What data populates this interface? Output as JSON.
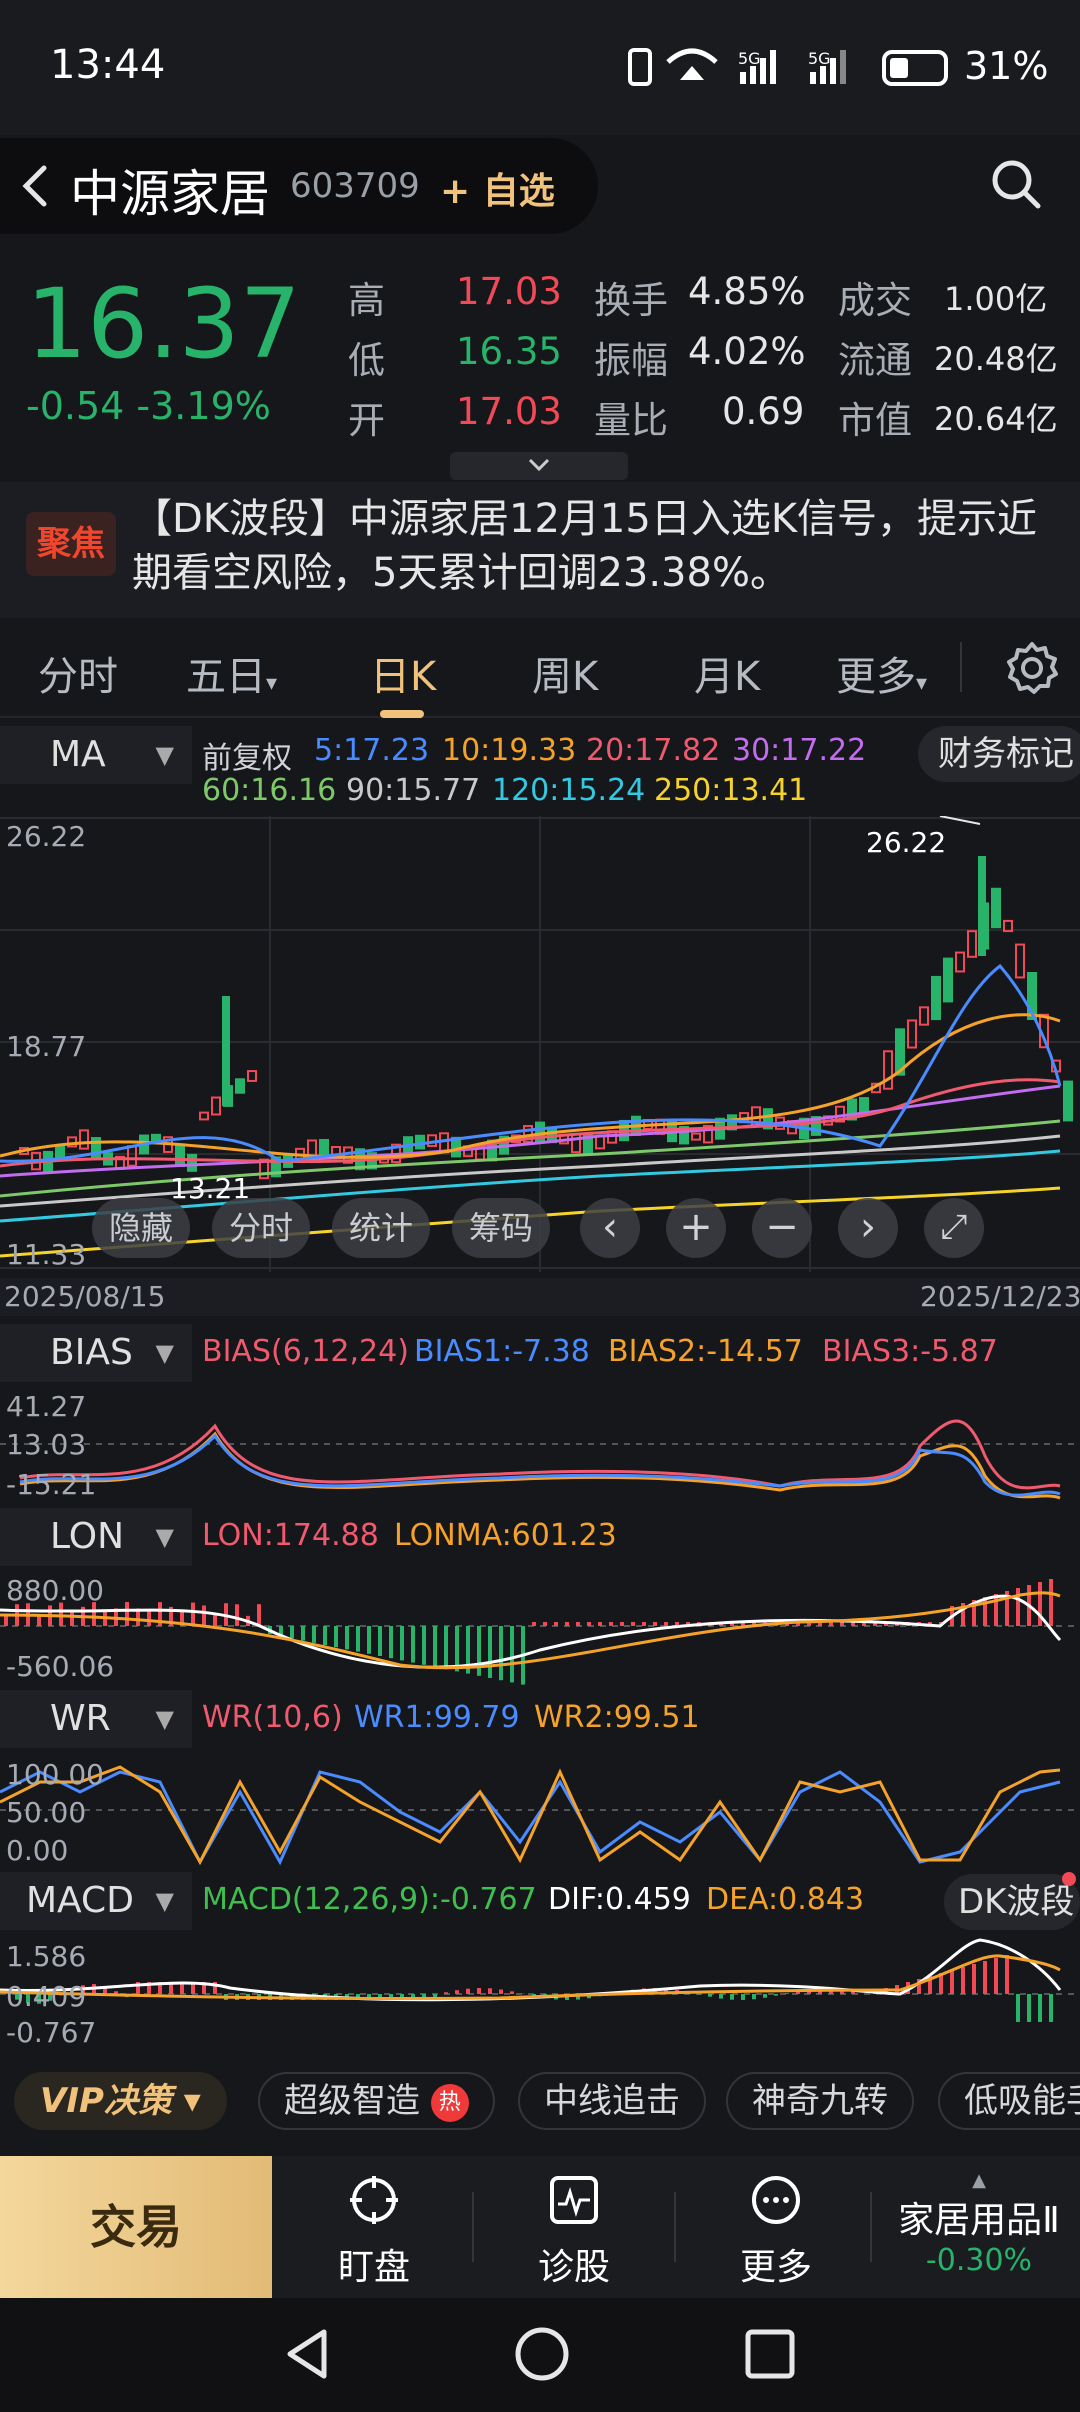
{
  "status": {
    "time": "13:44",
    "battery": "31%"
  },
  "header": {
    "name": "中源家居",
    "code": "603709",
    "add_label": "+ 自选"
  },
  "quote": {
    "price": "16.37",
    "change": "-0.54",
    "change_pct": "-3.19%",
    "rows": [
      {
        "k1": "高",
        "v1": "17.03",
        "k2": "换手",
        "v2": "4.85%",
        "k3": "成交",
        "v3": "1.00亿"
      },
      {
        "k1": "低",
        "v1": "16.35",
        "k2": "振幅",
        "v2": "4.02%",
        "k3": "流通",
        "v3": "20.48亿"
      },
      {
        "k1": "开",
        "v1": "17.03",
        "k2": "量比",
        "v2": "0.69",
        "k3": "市值",
        "v3": "20.64亿"
      }
    ]
  },
  "news": {
    "badge": "聚焦",
    "text": "【DK波段】中源家居12月15日入选K信号，提示近期看空风险，5天累计回调23.38%。"
  },
  "tabs": [
    "分时",
    "五日",
    "日K",
    "周K",
    "月K",
    "更多"
  ],
  "active_tab": "日K",
  "ma": {
    "selector": "MA",
    "adjust": "前复权",
    "items1": [
      {
        "t": "5:17.23",
        "c": "#4a8cff"
      },
      {
        "t": "10:19.33",
        "c": "#f5a22b"
      },
      {
        "t": "20:17.82",
        "c": "#f05a6e"
      },
      {
        "t": "30:17.22",
        "c": "#c46cf0"
      }
    ],
    "items2": [
      {
        "t": "60:16.16",
        "c": "#7ec86a"
      },
      {
        "t": "90:15.77",
        "c": "#c9c9c9"
      },
      {
        "t": "120:15.24",
        "c": "#33c9e0"
      },
      {
        "t": "250:13.41",
        "c": "#f5d32b"
      }
    ],
    "fin_mark": "财务标记"
  },
  "kchart": {
    "ymax": "26.22",
    "ymid": "18.77",
    "ymin": "11.33",
    "low_label": "13.21",
    "high_label": "26.22",
    "date_start": "2025/08/15",
    "date_end": "2025/12/23",
    "tools": [
      "隐藏",
      "分时",
      "统计",
      "筹码"
    ]
  },
  "bias": {
    "selector": "BIAS",
    "title": "BIAS(6,12,24)",
    "b1": "BIAS1:-7.38",
    "b2": "BIAS2:-14.57",
    "b3": "BIAS3:-5.87",
    "y1": "41.27",
    "y2": "13.03",
    "y3": "-15.21"
  },
  "lon": {
    "selector": "LON",
    "l1": "LON:174.88",
    "l2": "LONMA:601.23",
    "y1": "880.00",
    "y3": "-560.06"
  },
  "wr": {
    "selector": "WR",
    "title": "WR(10,6)",
    "w1": "WR1:99.79",
    "w2": "WR2:99.51",
    "y1": "100.00",
    "y2": "50.00",
    "y3": "0.00"
  },
  "macd": {
    "selector": "MACD",
    "title": "MACD(12,26,9):-0.767",
    "dif": "DIF:0.459",
    "dea": "DEA:0.843",
    "y1": "1.586",
    "y2": "0.409",
    "y3": "-0.767",
    "dk": "DK波段"
  },
  "strategy": {
    "vip": "VIP决策",
    "chips": [
      "超级智造",
      "中线追击",
      "神奇九转",
      "低吸能手"
    ],
    "hot": "热"
  },
  "bottom": {
    "trade": "交易",
    "items": [
      "盯盘",
      "诊股",
      "更多"
    ],
    "sector": "家居用品Ⅱ",
    "sector_chg": "-0.30%"
  }
}
